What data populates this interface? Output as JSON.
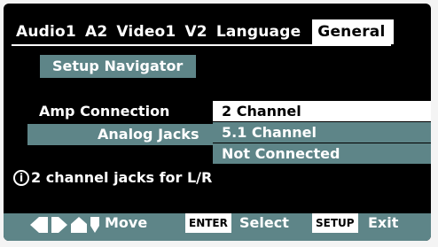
{
  "tabs": [
    {
      "label": "Audio1"
    },
    {
      "label": "A2"
    },
    {
      "label": "Video1"
    },
    {
      "label": "V2"
    },
    {
      "label": "Language"
    },
    {
      "label": "General",
      "active": true
    }
  ],
  "setup_navigator": "Setup Navigator",
  "amp_connection": "Amp Connection",
  "analog_jacks": "Analog Jacks",
  "dropdown": {
    "options": [
      "2 Channel",
      "5.1 Channel",
      "Not Connected"
    ],
    "selected": "2 Channel"
  },
  "info": {
    "icon": "info-icon",
    "text": "2 channel jacks for L/R"
  },
  "footer": {
    "move_label": "Move",
    "enter_key": "ENTER",
    "select_label": "Select",
    "setup_key": "SETUP",
    "exit_label": "Exit"
  },
  "colors": {
    "background": "#000000",
    "highlight": "#5e8588",
    "selected": "#ffffff"
  }
}
